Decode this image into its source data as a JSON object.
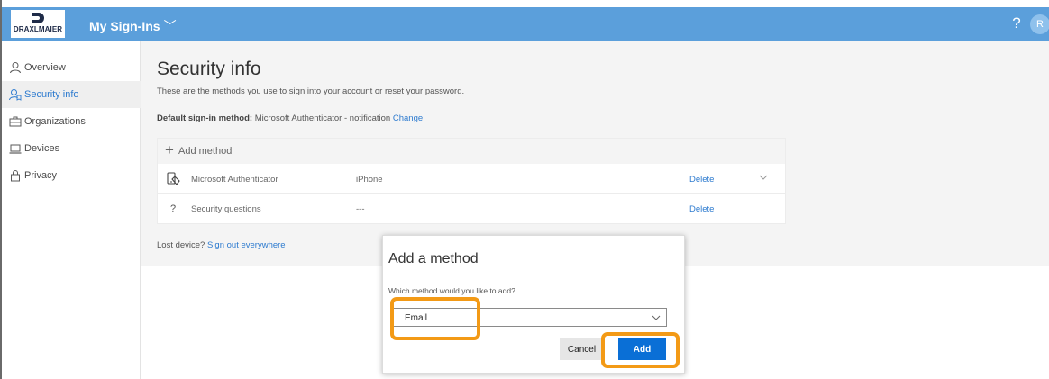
{
  "header": {
    "logo_text": "DRAXLMAIER",
    "title": "My Sign-Ins",
    "help_icon": "help-icon",
    "avatar_initial": "R",
    "colors": {
      "bar": "#5b9fdb"
    }
  },
  "sidebar": {
    "items": [
      {
        "label": "Overview",
        "icon": "person-icon",
        "active": false
      },
      {
        "label": "Security info",
        "icon": "security-info-icon",
        "active": true
      },
      {
        "label": "Organizations",
        "icon": "briefcase-icon",
        "active": false
      },
      {
        "label": "Devices",
        "icon": "laptop-icon",
        "active": false
      },
      {
        "label": "Privacy",
        "icon": "lock-icon",
        "active": false
      }
    ]
  },
  "main": {
    "title": "Security info",
    "description": "These are the methods you use to sign into your account or reset your password.",
    "default_method": {
      "label": "Default sign-in method:",
      "value": "Microsoft Authenticator - notification",
      "change_link": "Change"
    },
    "add_method_label": "Add method",
    "methods": [
      {
        "name": "Microsoft Authenticator",
        "detail": "iPhone",
        "delete_label": "Delete",
        "icon": "phone-icon",
        "expandable": true
      },
      {
        "name": "Security questions",
        "detail": "---",
        "delete_label": "Delete",
        "icon": "question-icon",
        "expandable": false
      }
    ],
    "lost_device": {
      "text": "Lost device?",
      "link": "Sign out everywhere"
    }
  },
  "modal": {
    "title": "Add a method",
    "question": "Which method would you like to add?",
    "selected_value": "Email",
    "cancel_label": "Cancel",
    "add_label": "Add",
    "colors": {
      "primary": "#0a6fd6",
      "highlight": "#f39a16"
    }
  }
}
